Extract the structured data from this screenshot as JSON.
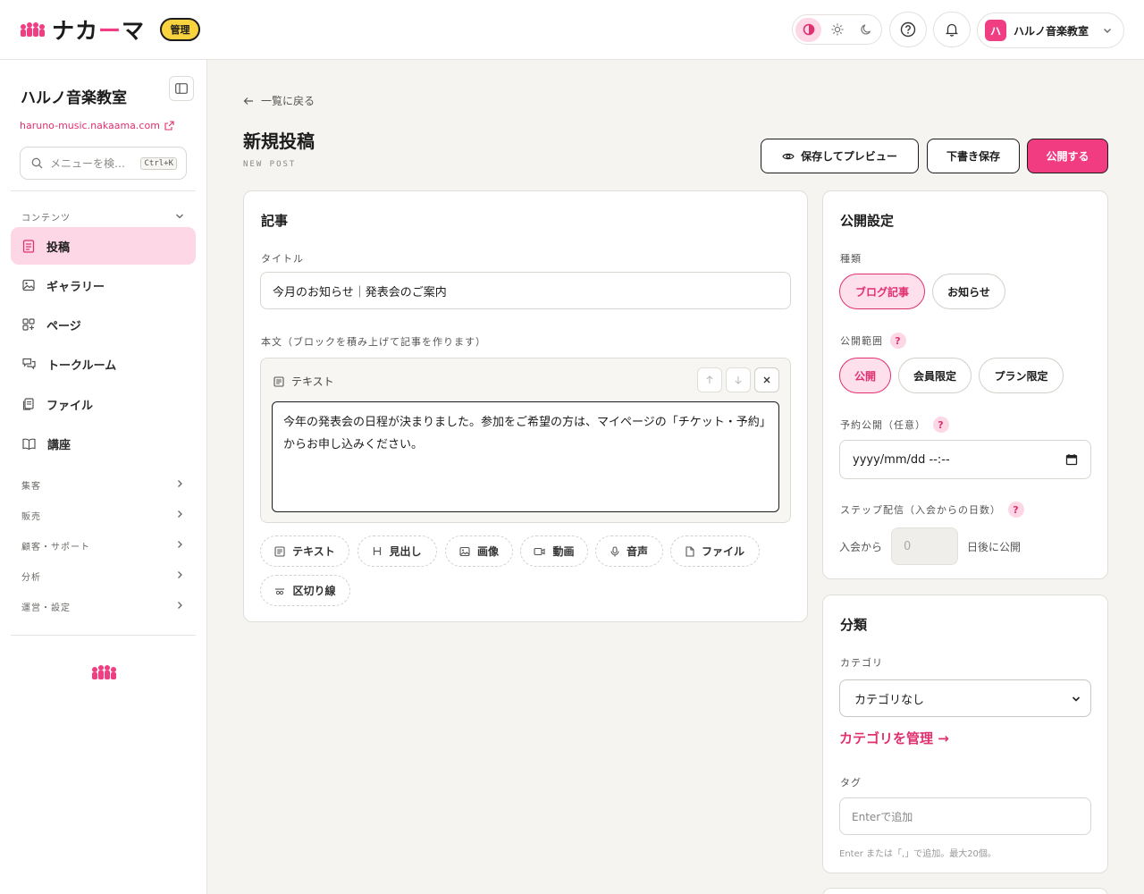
{
  "brand": {
    "name_a": "ナカ",
    "name_b": "ー",
    "name_c": "マ",
    "badge": "管理"
  },
  "header": {
    "account_initial": "ハ",
    "account_name": "ハルノ音楽教室"
  },
  "sidebar": {
    "title": "ハルノ音楽教室",
    "domain": "haruno-music.nakaama.com",
    "search_placeholder": "メニューを検…",
    "search_shortcut": "Ctrl+K",
    "content_section": "コンテンツ",
    "items": [
      {
        "label": "投稿",
        "icon": "post-icon"
      },
      {
        "label": "ギャラリー",
        "icon": "image-icon"
      },
      {
        "label": "ページ",
        "icon": "page-grid-icon"
      },
      {
        "label": "トークルーム",
        "icon": "chat-icon"
      },
      {
        "label": "ファイル",
        "icon": "file-icon"
      },
      {
        "label": "講座",
        "icon": "book-icon"
      }
    ],
    "groups": [
      "集客",
      "販売",
      "顧客・サポート",
      "分析",
      "運営・設定"
    ]
  },
  "page": {
    "back": "一覧に戻る",
    "title": "新規投稿",
    "subtitle": "NEW POST",
    "preview_btn": "保存してプレビュー",
    "draft_btn": "下書き保存",
    "publish_btn": "公開する"
  },
  "article": {
    "heading": "記事",
    "title_label": "タイトル",
    "title_value": "今月のお知らせ｜発表会のご案内",
    "body_label": "本文（ブロックを積み上げて記事を作ります）",
    "block_type": "テキスト",
    "block_text": "今年の発表会の日程が決まりました。参加をご希望の方は、マイページの「チケット・予約」からお申し込みください。",
    "add_blocks": [
      "テキスト",
      "見出し",
      "画像",
      "動画",
      "音声",
      "ファイル",
      "区切り線"
    ]
  },
  "publish": {
    "heading": "公開設定",
    "type_label": "種類",
    "types": [
      "ブログ記事",
      "お知らせ"
    ],
    "scope_label": "公開範囲",
    "scopes": [
      "公開",
      "会員限定",
      "プラン限定"
    ],
    "schedule_label": "予約公開（任意）",
    "schedule_placeholder": "yyyy/mm/dd --:--",
    "step_label": "ステップ配信（入会からの日数）",
    "step_prefix": "入会から",
    "step_value": "0",
    "step_suffix": "日後に公開",
    "help_mark": "?"
  },
  "classify": {
    "heading": "分類",
    "category_label": "カテゴリ",
    "category_value": "カテゴリなし",
    "manage_link": "カテゴリを管理 →",
    "tag_label": "タグ",
    "tag_placeholder": "Enterで追加",
    "tag_hint": "Enter または「,」で追加。最大20個。"
  },
  "colors": {
    "accent": "#f03e82",
    "badge": "#f9d23f",
    "active_bg": "#fdd7e6"
  }
}
